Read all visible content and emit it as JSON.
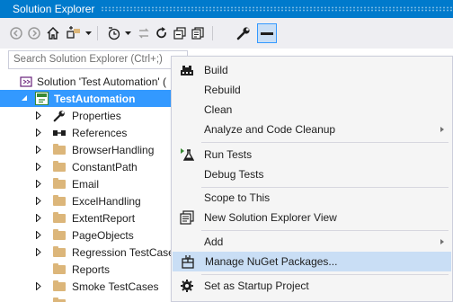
{
  "window": {
    "title": "Solution Explorer"
  },
  "search": {
    "placeholder": "Search Solution Explorer (Ctrl+;)"
  },
  "tree": {
    "solution": "Solution 'Test Automation' (",
    "project": "TestAutomation",
    "items": [
      {
        "label": "Properties",
        "icon": "wrench-icon"
      },
      {
        "label": "References",
        "icon": "references-icon"
      },
      {
        "label": "BrowserHandling",
        "icon": "folder-icon"
      },
      {
        "label": "ConstantPath",
        "icon": "folder-icon"
      },
      {
        "label": "Email",
        "icon": "folder-icon"
      },
      {
        "label": "ExcelHandling",
        "icon": "folder-icon"
      },
      {
        "label": "ExtentReport",
        "icon": "folder-icon"
      },
      {
        "label": "PageObjects",
        "icon": "folder-icon"
      },
      {
        "label": "Regression TestCases",
        "icon": "folder-icon"
      },
      {
        "label": "Reports",
        "icon": "folder-icon"
      },
      {
        "label": "Smoke TestCases",
        "icon": "folder-icon"
      }
    ]
  },
  "menu": {
    "build": "Build",
    "rebuild": "Rebuild",
    "clean": "Clean",
    "analyze": "Analyze and Code Cleanup",
    "run_tests": "Run Tests",
    "debug_tests": "Debug Tests",
    "scope": "Scope to This",
    "new_view": "New Solution Explorer View",
    "add": "Add",
    "nuget": "Manage NuGet Packages...",
    "startup": "Set as Startup Project"
  },
  "colors": {
    "accent": "#007acc",
    "selection": "#3399ff",
    "menu_highlight": "#c9def5",
    "folder": "#dcb67a"
  }
}
